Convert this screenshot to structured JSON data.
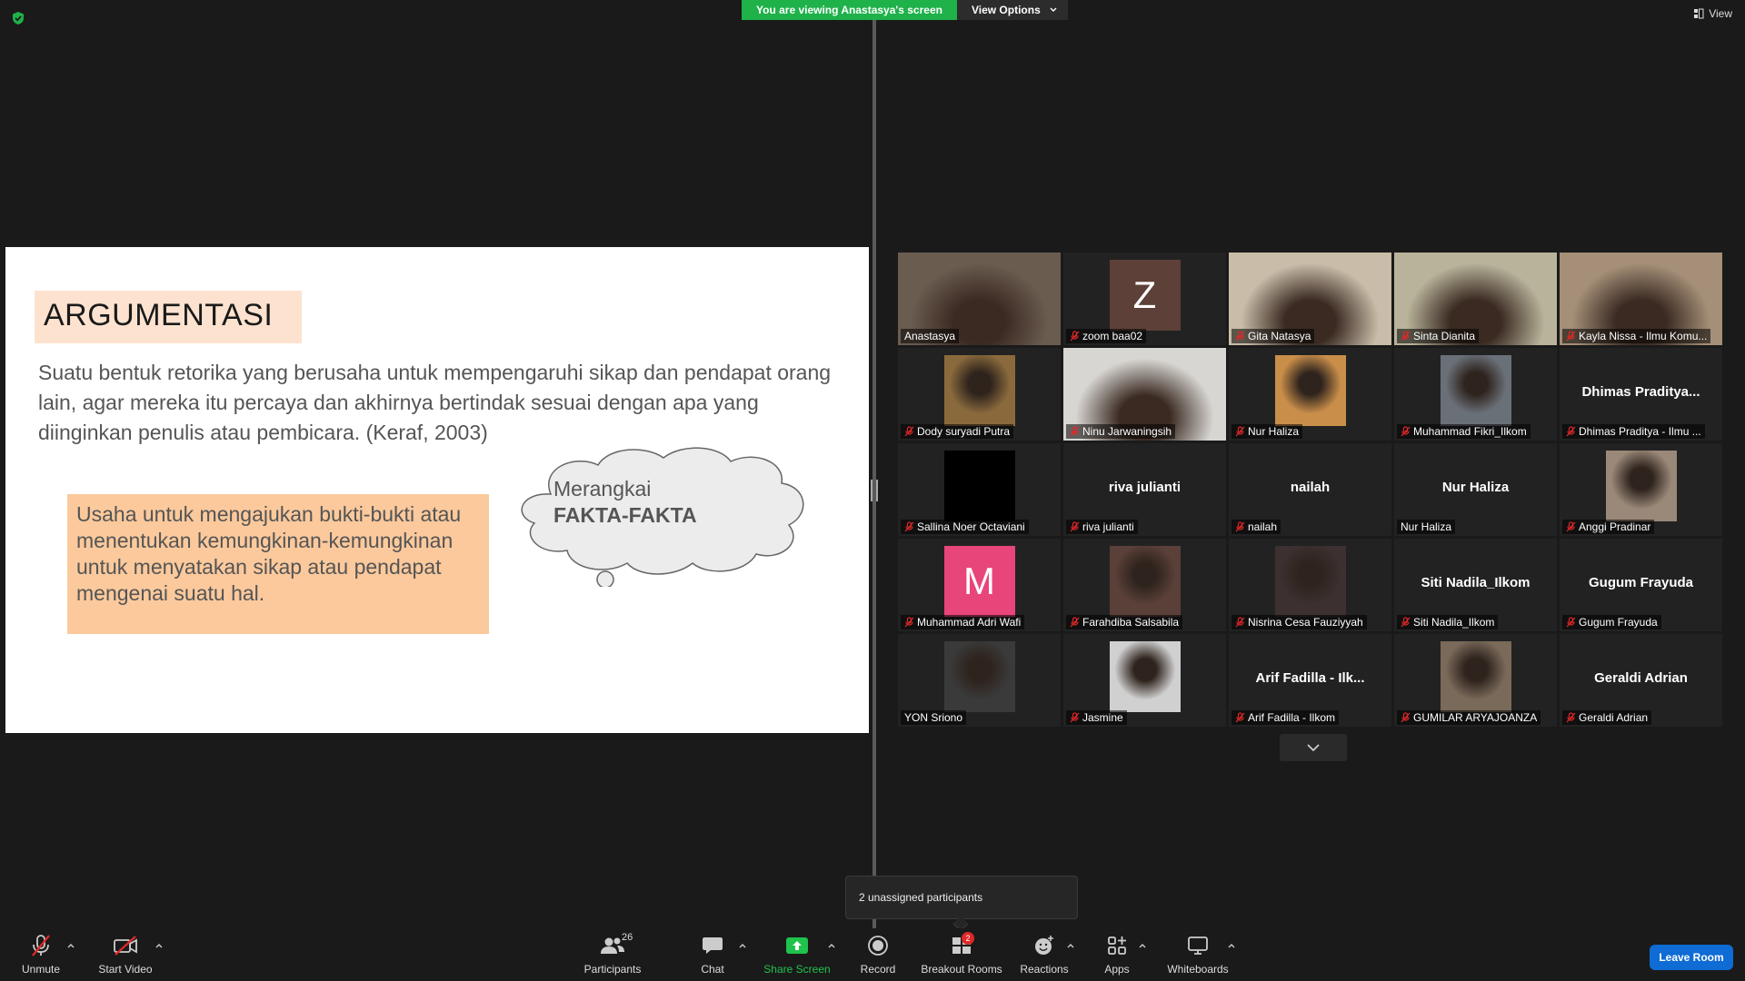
{
  "banner": {
    "viewing_text": "You are viewing Anastasya's screen",
    "view_options_label": "View Options"
  },
  "top_right": {
    "view_label": "View"
  },
  "slide": {
    "title": "ARGUMENTASI",
    "body": "Suatu bentuk retorika yang berusaha untuk mempengaruhi sikap dan pendapat orang lain, agar mereka itu percaya dan akhirnya bertindak sesuai dengan apa yang diinginkan penulis atau pembicara. (Keraf, 2003)",
    "box_text": "Usaha untuk mengajukan bukti-bukti atau menentukan kemungkinan-kemungkinan untuk menyatakan sikap atau pendapat mengenai suatu hal.",
    "cloud_line1": "Merangkai",
    "cloud_line2": "FAKTA-FAKTA"
  },
  "participants": [
    {
      "name": "Anastasya",
      "muted": false,
      "kind": "video",
      "tone": "#6b5c50"
    },
    {
      "name": "zoom baa02",
      "muted": true,
      "kind": "letter",
      "letter": "Z",
      "color": "#5d4037"
    },
    {
      "name": "Gita Natasya",
      "muted": true,
      "kind": "video",
      "tone": "#c9bca8"
    },
    {
      "name": "Sinta Dianita",
      "muted": true,
      "kind": "video",
      "tone": "#b8b39a"
    },
    {
      "name": "Kayla Nissa - Ilmu Komu...",
      "muted": true,
      "kind": "video",
      "tone": "#a58f78"
    },
    {
      "name": "Dody suryadi Putra",
      "muted": true,
      "kind": "photo",
      "tone": "#8a6a3c"
    },
    {
      "name": "Ninu Jarwaningsih",
      "muted": true,
      "kind": "video",
      "tone": "#d8d6d2"
    },
    {
      "name": "Nur Haliza",
      "muted": true,
      "kind": "photo",
      "tone": "#c98e4a"
    },
    {
      "name": "Muhammad Fikri_Ilkom",
      "muted": true,
      "kind": "photo",
      "tone": "#6a7078"
    },
    {
      "name": "Dhimas Praditya - Ilmu ...",
      "muted": true,
      "kind": "name",
      "display": "Dhimas  Praditya..."
    },
    {
      "name": "Sallina Noer Octaviani",
      "muted": true,
      "kind": "letter",
      "letter": "",
      "color": "#000000"
    },
    {
      "name": "riva julianti",
      "muted": true,
      "kind": "name",
      "display": "riva julianti"
    },
    {
      "name": "nailah",
      "muted": true,
      "kind": "name",
      "display": "nailah"
    },
    {
      "name": "Nur Haliza",
      "muted": false,
      "kind": "name",
      "display": "Nur Haliza"
    },
    {
      "name": "Anggi Pradinar",
      "muted": true,
      "kind": "photo",
      "tone": "#9a8878"
    },
    {
      "name": "Muhammad Adri Wafi",
      "muted": true,
      "kind": "letter",
      "letter": "M",
      "color": "#e8457a"
    },
    {
      "name": "Farahdiba Salsabila",
      "muted": true,
      "kind": "photo",
      "tone": "#5a4038"
    },
    {
      "name": "Nisrina Cesa Fauziyyah",
      "muted": true,
      "kind": "photo",
      "tone": "#3c3030"
    },
    {
      "name": "Siti Nadila_Ilkom",
      "muted": true,
      "kind": "name",
      "display": "Siti Nadila_Ilkom"
    },
    {
      "name": "Gugum Frayuda",
      "muted": true,
      "kind": "name",
      "display": "Gugum Frayuda"
    },
    {
      "name": "YON Sriono",
      "muted": false,
      "kind": "photo",
      "tone": "#3a3a3a"
    },
    {
      "name": "Jasmine",
      "muted": true,
      "kind": "photo",
      "tone": "#d0d0d0"
    },
    {
      "name": "Arif Fadilla - Ilkom",
      "muted": true,
      "kind": "name",
      "display": "Arif Fadilla - Ilk..."
    },
    {
      "name": "GUMILAR ARYAJOANZA",
      "muted": true,
      "kind": "photo",
      "tone": "#7a6a5a"
    },
    {
      "name": "Geraldi Adrian",
      "muted": true,
      "kind": "name",
      "display": "Geraldi Adrian"
    }
  ],
  "tooltip": {
    "text": "2 unassigned participants"
  },
  "toolbar": {
    "unmute": "Unmute",
    "start_video": "Start Video",
    "participants": "Participants",
    "participants_count": "26",
    "chat": "Chat",
    "share_screen": "Share Screen",
    "record": "Record",
    "breakout_rooms": "Breakout Rooms",
    "breakout_badge": "2",
    "reactions": "Reactions",
    "apps": "Apps",
    "whiteboards": "Whiteboards",
    "leave_room": "Leave Room"
  },
  "colors": {
    "share_green": "#1fb14a",
    "active_speaker": "#d7e73a",
    "leave_blue": "#0e6cd4",
    "mute_red": "#e02828"
  }
}
